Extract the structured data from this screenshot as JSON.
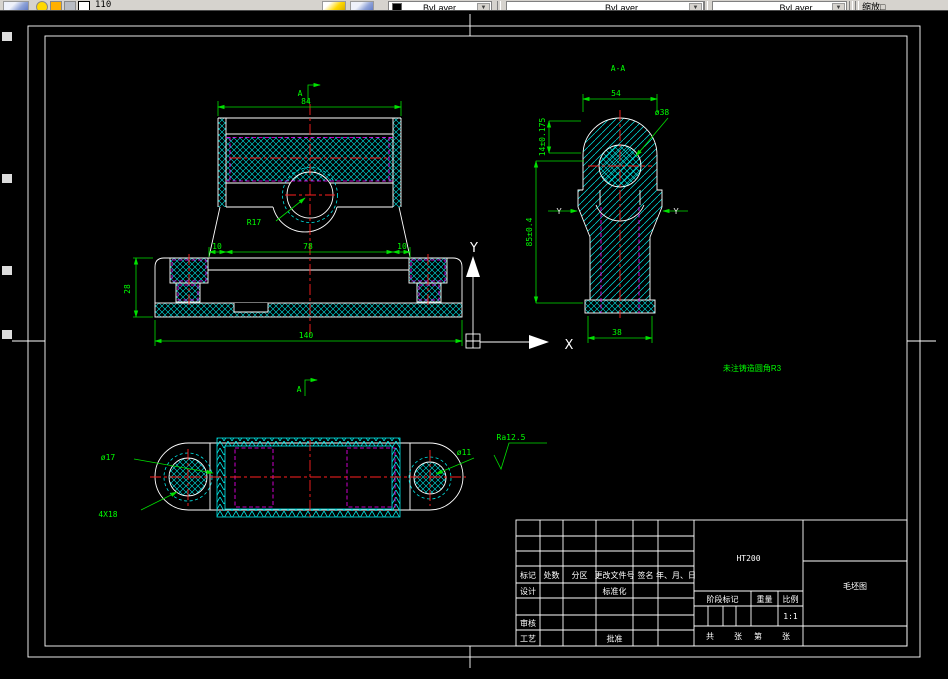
{
  "toolbar": {
    "layer_value": "110",
    "color_value": "ByLayer",
    "linetype_value": "ByLayer",
    "lineweight_value": "ByLayer",
    "right_panel_label": "缩放□",
    "dropdown_arrow": "▼"
  },
  "colors": {
    "outline": "#ffffff",
    "hatch": "#00e8e8",
    "centerline": "#ff2020",
    "dimension": "#00e000",
    "hidden_line": "#ff00ff",
    "note": "#00ff00",
    "toolbar_bg": "#d6d3ce"
  },
  "drawing": {
    "note": "未注铸造圆角R3",
    "ucs": {
      "x": "X",
      "y": "Y"
    },
    "front_view": {
      "section_label": "A",
      "dim_top_width": "84",
      "dim_step_left": "10",
      "dim_step_mid": "78",
      "dim_step_right": "10",
      "dim_left_height": "28",
      "dim_bottom_width": "140",
      "radius_label": "R17"
    },
    "section_view": {
      "title": "A-A",
      "dim_top_width": "54",
      "dia_label": "ø38",
      "dim_height_tol": "14±0.175",
      "dim_overall_tol": "85±0.4",
      "dim_bottom_width": "38",
      "datum_left": "Y",
      "datum_right": "Y"
    },
    "plan_view": {
      "section_label": "A",
      "dia_left": "ø17",
      "holes_label": "4X18",
      "dia_right": "ø11",
      "roughness": "Ra12.5"
    }
  },
  "title_block": {
    "material": "HT200",
    "drawing_title": "毛坯图",
    "header_row": [
      "标记",
      "处数",
      "分区",
      "更改文件号",
      "签名",
      "年、月、日"
    ],
    "design_label": "设计",
    "standard_label": "标准化",
    "audit_label": "审核",
    "process_label": "工艺",
    "approve_label": "批准",
    "stage_label": "阶段标记",
    "weight_label": "重量",
    "scale_label": "比例",
    "scale_value": "1:1",
    "sheet_total_label": "共",
    "sheet_unit1": "张",
    "sheet_page_label": "第",
    "sheet_unit2": "张"
  }
}
